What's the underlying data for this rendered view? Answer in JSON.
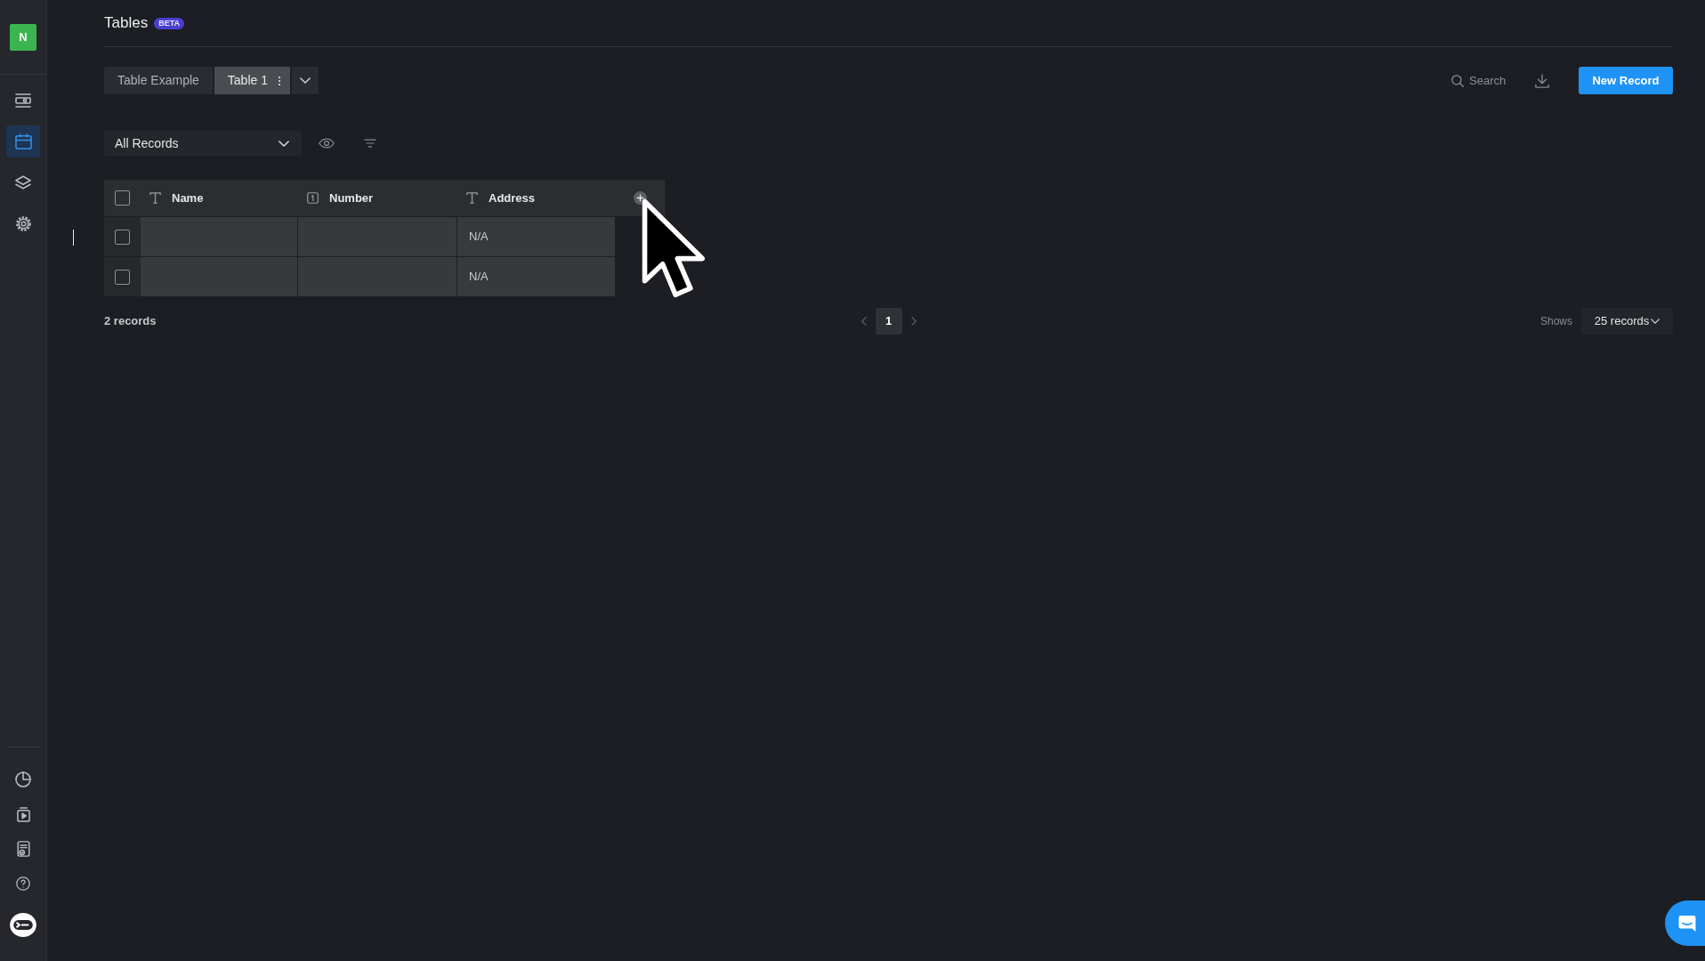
{
  "sidebar": {
    "logo": "N",
    "top_items": [
      {
        "kind": "panel",
        "selected": false
      },
      {
        "kind": "calendar",
        "selected": true
      },
      {
        "kind": "layers",
        "selected": false
      },
      {
        "kind": "gear",
        "selected": false
      }
    ],
    "bottom_items": [
      {
        "kind": "pie",
        "selected": false
      },
      {
        "kind": "play",
        "selected": false
      },
      {
        "kind": "document",
        "selected": false
      },
      {
        "kind": "help",
        "selected": false
      },
      {
        "kind": "robot",
        "selected": false
      }
    ]
  },
  "header": {
    "title": "Tables",
    "badge": "BETA"
  },
  "tabs": [
    {
      "label": "Table Example",
      "selected": false
    },
    {
      "label": "Table 1",
      "selected": true
    }
  ],
  "toolbar": {
    "search": {
      "placeholder": "Search"
    },
    "new_record_button": "New Record"
  },
  "view_selector": {
    "value": "All Records"
  },
  "table": {
    "all_checked": false,
    "columns": [
      {
        "label": "Name",
        "kind": "text"
      },
      {
        "label": "Number",
        "kind": "number"
      },
      {
        "label": "Address",
        "kind": "text"
      }
    ],
    "rows": [
      {
        "checked": false,
        "cells": [
          null,
          null,
          "N/A"
        ]
      },
      {
        "checked": false,
        "cells": [
          null,
          null,
          "N/A"
        ]
      }
    ]
  },
  "footer": {
    "count": "2 records",
    "pages": [
      {
        "label": "1",
        "selected": true
      }
    ],
    "page_size_label": "Shows",
    "page_size": "25 records"
  }
}
